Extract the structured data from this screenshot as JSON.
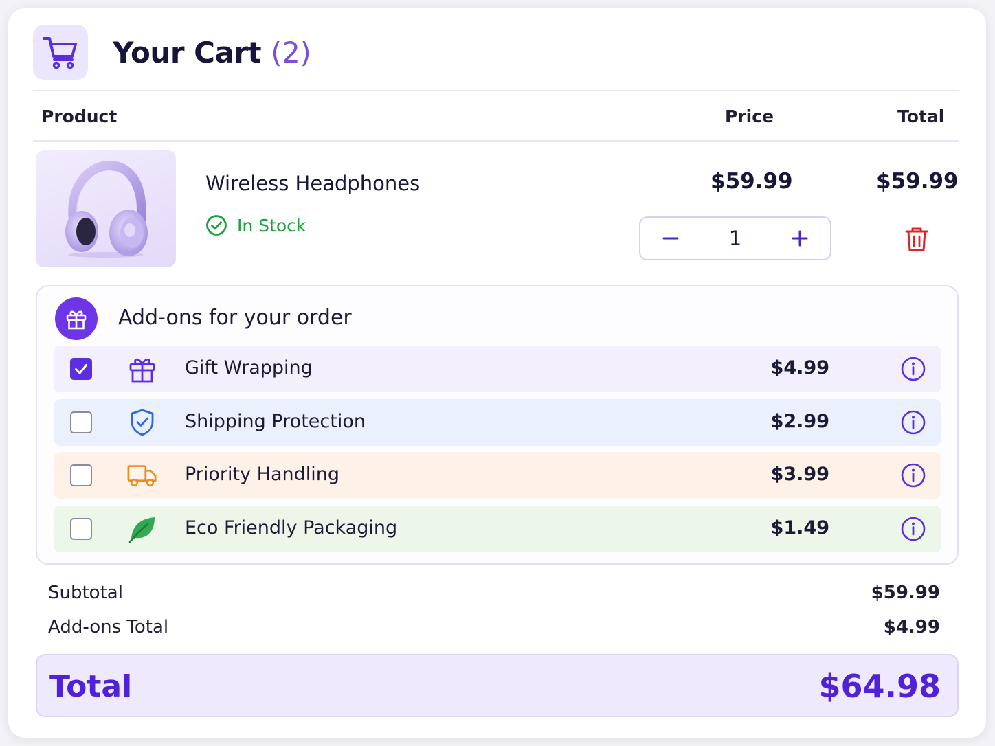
{
  "header": {
    "title": "Your Cart",
    "count": "(2)",
    "icon": "cart-icon"
  },
  "columns": {
    "product": "Product",
    "price": "Price",
    "total": "Total"
  },
  "item": {
    "name": "Wireless Headphones",
    "stock_status": "In Stock",
    "price": "$59.99",
    "total": "$59.99",
    "quantity": "1",
    "decrement_symbol": "−",
    "increment_symbol": "+"
  },
  "addons": {
    "title": "Add-ons for your order",
    "items": [
      {
        "label": "Gift Wrapping",
        "price": "$4.99",
        "checked": true,
        "icon": "gift-icon",
        "bg": "#f3eefd"
      },
      {
        "label": "Shipping Protection",
        "price": "$2.99",
        "checked": false,
        "icon": "shield-check-icon",
        "bg": "#eaf0fc"
      },
      {
        "label": "Priority Handling",
        "price": "$3.99",
        "checked": false,
        "icon": "truck-icon",
        "bg": "#fdf1e8"
      },
      {
        "label": "Eco Friendly Packaging",
        "price": "$1.49",
        "checked": false,
        "icon": "leaf-icon",
        "bg": "#ecf6e9"
      }
    ]
  },
  "summary": {
    "subtotal_label": "Subtotal",
    "subtotal_value": "$59.99",
    "addons_label": "Add-ons Total",
    "addons_value": "$4.99",
    "total_label": "Total",
    "total_value": "$64.98"
  },
  "colors": {
    "accent": "#5b2fe0",
    "in_stock": "#18a23a",
    "delete": "#e02424"
  }
}
